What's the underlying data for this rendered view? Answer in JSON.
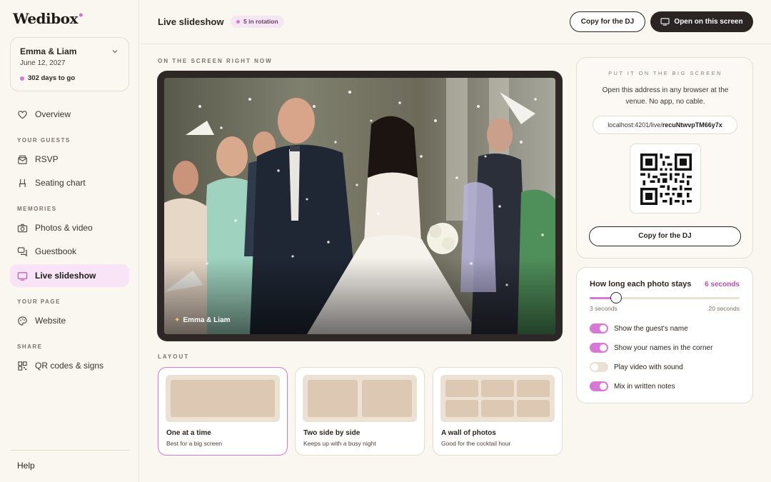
{
  "brand": {
    "logo": "Wedibox",
    "accent": "#d878d5"
  },
  "event": {
    "name": "Emma & Liam",
    "date": "June 12, 2027",
    "countdown": "302 days to go"
  },
  "sidebar": {
    "overview": "Overview",
    "sections": {
      "guests": "YOUR GUESTS",
      "memories": "MEMORIES",
      "page": "YOUR PAGE",
      "share": "SHARE"
    },
    "items": {
      "rsvp": "RSVP",
      "seating": "Seating chart",
      "photos": "Photos & video",
      "guestbook": "Guestbook",
      "slideshow": "Live slideshow",
      "website": "Website",
      "qr": "QR codes & signs"
    },
    "help": "Help"
  },
  "header": {
    "title": "Live slideshow",
    "badge": "5 in rotation",
    "copy_dj": "Copy for the DJ",
    "open_screen": "Open on this screen"
  },
  "main": {
    "now_label": "ON THE SCREEN RIGHT NOW",
    "caption": "Emma & Liam",
    "layout_label": "LAYOUT",
    "layouts": [
      {
        "title": "One at a time",
        "subtitle": "Best for a big screen",
        "selected": true
      },
      {
        "title": "Two side by side",
        "subtitle": "Keeps up with a busy night",
        "selected": false
      },
      {
        "title": "A wall of photos",
        "subtitle": "Good for the cocktail hour",
        "selected": false
      }
    ]
  },
  "big_screen": {
    "label": "PUT IT ON THE BIG SCREEN",
    "description": "Open this address in any browser at the venue. No app, no cable.",
    "url_prefix": "localhost:4201/live/",
    "url_code": "recuNtwvpTM66y7x",
    "copy_dj": "Copy for the DJ"
  },
  "settings": {
    "duration_title": "How long each photo stays",
    "duration_value": "6 seconds",
    "slider": {
      "min_label": "3 seconds",
      "max_label": "20 seconds",
      "min": 3,
      "max": 20,
      "value": 6
    },
    "toggles": [
      {
        "label": "Show the guest's name",
        "on": true
      },
      {
        "label": "Show your names in the corner",
        "on": true
      },
      {
        "label": "Play video with sound",
        "on": false
      },
      {
        "label": "Mix in written notes",
        "on": true
      }
    ]
  }
}
